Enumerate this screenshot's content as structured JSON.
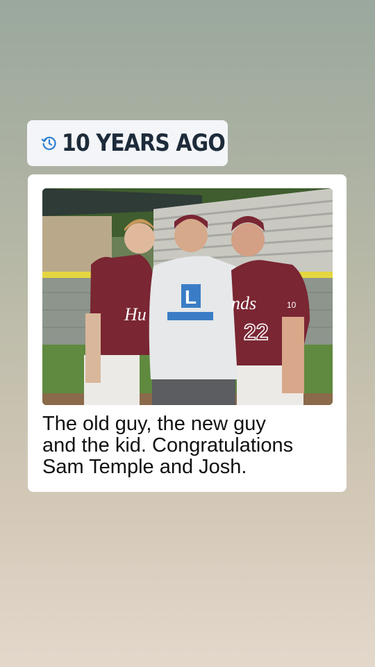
{
  "memory": {
    "label": "10 YEARS AGO",
    "icon": "history-clock-icon",
    "accent": "#2e7dd1"
  },
  "post": {
    "caption": "The old guy, the new guy\nand the kid.  Congratulations\nSam Temple and Josh.",
    "photo": {
      "description_icon": "photo",
      "jersey_left": "Hu",
      "jersey_right": "nds",
      "jersey_number": "22",
      "sleeve_number": "10",
      "shirt_text": "L",
      "colors": {
        "maroon": "#7a2633",
        "field": "#5f8a3f"
      }
    }
  }
}
